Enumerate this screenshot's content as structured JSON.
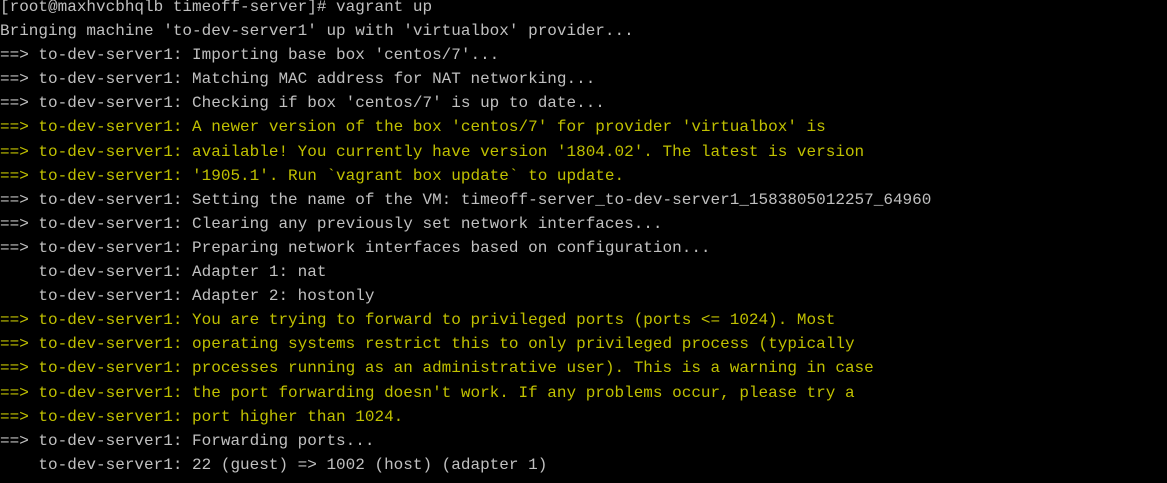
{
  "terminal": {
    "background": "#000000",
    "colors": {
      "white": "#c0c0c0",
      "yellow": "#c0c000"
    },
    "lines": [
      {
        "text": "[root@maxhvcbhqlb timeoff-server]# vagrant up",
        "color": "white"
      },
      {
        "text": "Bringing machine 'to-dev-server1' up with 'virtualbox' provider...",
        "color": "white"
      },
      {
        "text": "==> to-dev-server1: Importing base box 'centos/7'...",
        "color": "white"
      },
      {
        "text": "==> to-dev-server1: Matching MAC address for NAT networking...",
        "color": "white"
      },
      {
        "text": "==> to-dev-server1: Checking if box 'centos/7' is up to date...",
        "color": "white"
      },
      {
        "text": "==> to-dev-server1: A newer version of the box 'centos/7' for provider 'virtualbox' is",
        "color": "yellow"
      },
      {
        "text": "==> to-dev-server1: available! You currently have version '1804.02'. The latest is version",
        "color": "yellow"
      },
      {
        "text": "==> to-dev-server1: '1905.1'. Run `vagrant box update` to update.",
        "color": "yellow"
      },
      {
        "text": "==> to-dev-server1: Setting the name of the VM: timeoff-server_to-dev-server1_1583805012257_64960",
        "color": "white"
      },
      {
        "text": "==> to-dev-server1: Clearing any previously set network interfaces...",
        "color": "white"
      },
      {
        "text": "==> to-dev-server1: Preparing network interfaces based on configuration...",
        "color": "white"
      },
      {
        "text": "    to-dev-server1: Adapter 1: nat",
        "color": "white"
      },
      {
        "text": "    to-dev-server1: Adapter 2: hostonly",
        "color": "white"
      },
      {
        "text": "==> to-dev-server1: You are trying to forward to privileged ports (ports <= 1024). Most",
        "color": "yellow"
      },
      {
        "text": "==> to-dev-server1: operating systems restrict this to only privileged process (typically",
        "color": "yellow"
      },
      {
        "text": "==> to-dev-server1: processes running as an administrative user). This is a warning in case",
        "color": "yellow"
      },
      {
        "text": "==> to-dev-server1: the port forwarding doesn't work. If any problems occur, please try a",
        "color": "yellow"
      },
      {
        "text": "==> to-dev-server1: port higher than 1024.",
        "color": "yellow"
      },
      {
        "text": "==> to-dev-server1: Forwarding ports...",
        "color": "white"
      },
      {
        "text": "    to-dev-server1: 22 (guest) => 1002 (host) (adapter 1)",
        "color": "white"
      }
    ]
  }
}
